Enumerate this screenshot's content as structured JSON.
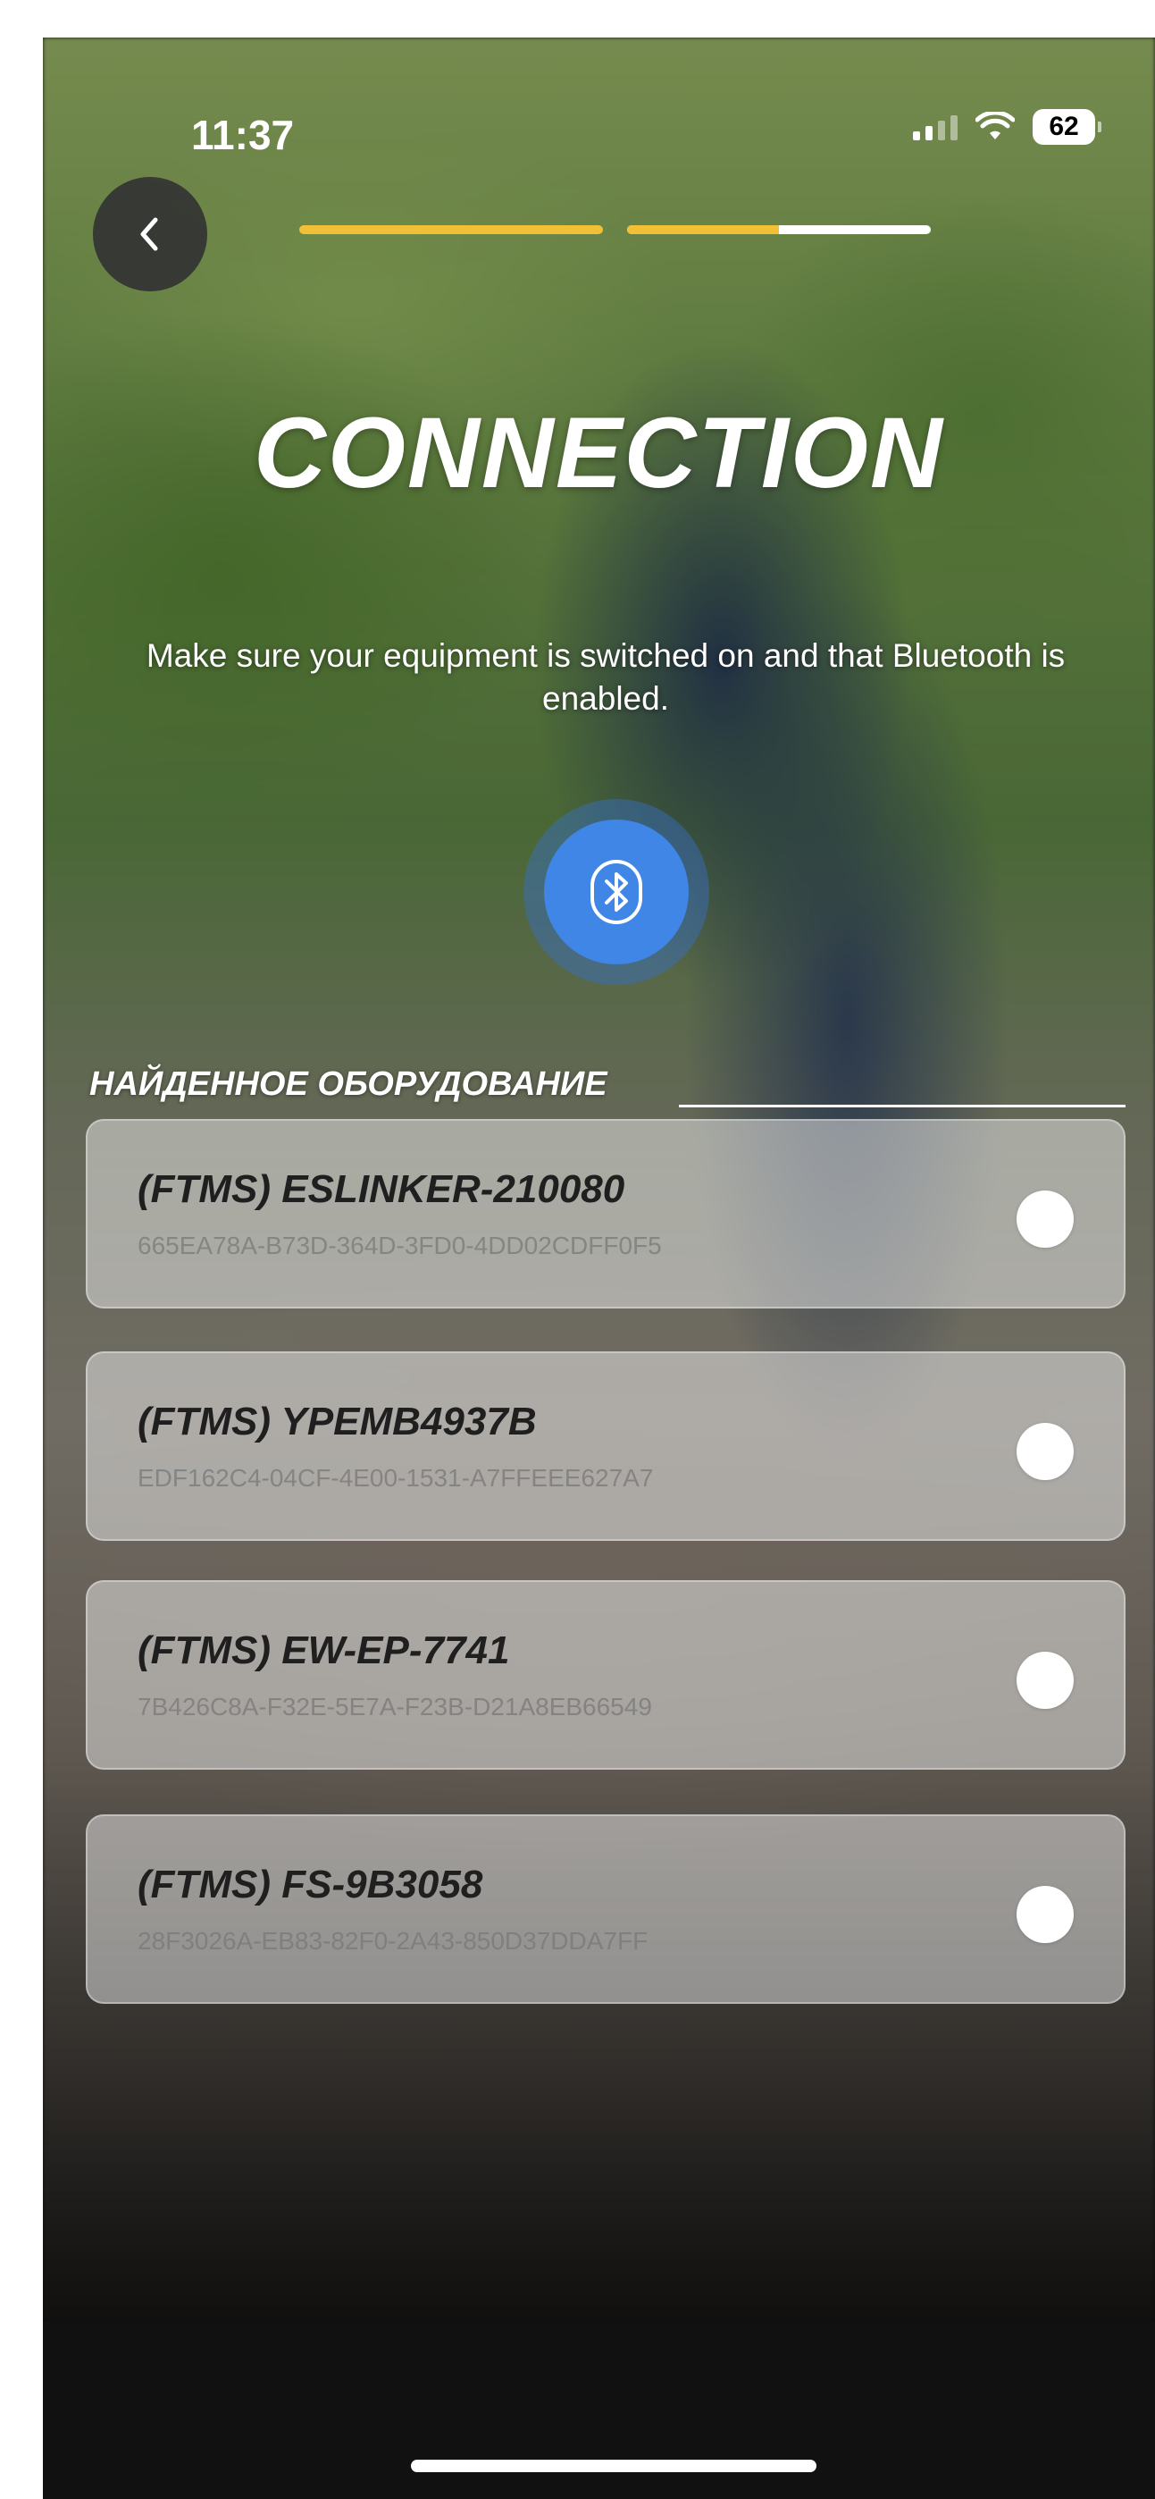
{
  "status_bar": {
    "time": "11:37",
    "battery": "62",
    "icons": [
      "signal-icon",
      "wifi-icon",
      "battery-icon"
    ]
  },
  "header": {
    "back_icon": "chevron-left-icon",
    "progress": {
      "steps": 2,
      "step1_fill": 1.0,
      "step2_fill": 0.5
    },
    "title": "CONNECTION",
    "subtitle": "Make sure your equipment is switched on and that Bluetooth is enabled."
  },
  "bluetooth_button": {
    "icon": "bluetooth-icon"
  },
  "found_section": {
    "label": "НАЙДЕННОЕ ОБОРУДОВАНИЕ"
  },
  "devices": [
    {
      "name": "(FTMS) ESLINKER-210080",
      "id": "665EA78A-B73D-364D-3FD0-4DD02CDFF0F5"
    },
    {
      "name": "(FTMS) YPEMB4937B",
      "id": "EDF162C4-04CF-4E00-1531-A7FFEEE627A7"
    },
    {
      "name": "(FTMS) EW-EP-7741",
      "id": "7B426C8A-F32E-5E7A-F23B-D21A8EB66549"
    },
    {
      "name": "(FTMS) FS-9B3058",
      "id": "28F3026A-EB83-82F0-2A43-850D37DDA7FF"
    }
  ],
  "colors": {
    "accent": "#f2c037",
    "bluetooth": "#3f86e6",
    "card_bg": "rgba(235,235,235,0.5)"
  }
}
